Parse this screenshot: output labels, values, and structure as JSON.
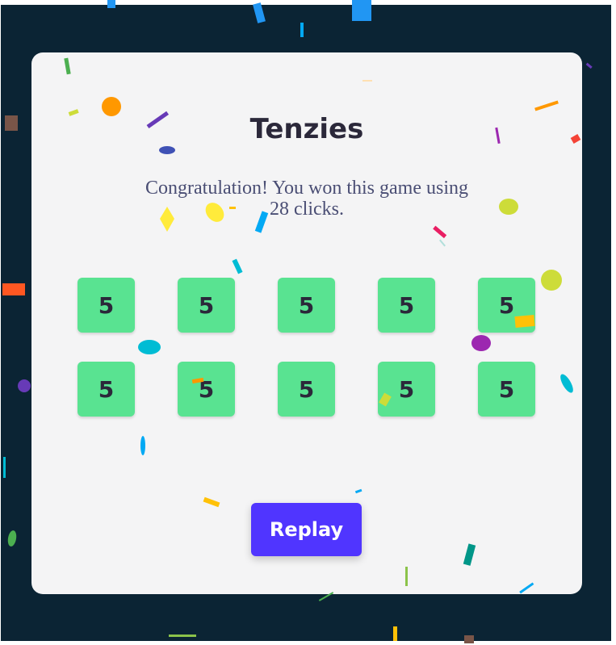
{
  "app": {
    "title": "Tenzies",
    "message": "Congratulation! You won this game using 28 clicks.",
    "dice": [
      "5",
      "5",
      "5",
      "5",
      "5",
      "5",
      "5",
      "5",
      "5",
      "5"
    ],
    "replay_label": "Replay"
  },
  "colors": {
    "background": "#0b2434",
    "panel": "#f4f4f5",
    "die": "#59e391",
    "button": "#5035ff",
    "title": "#2b283a"
  }
}
